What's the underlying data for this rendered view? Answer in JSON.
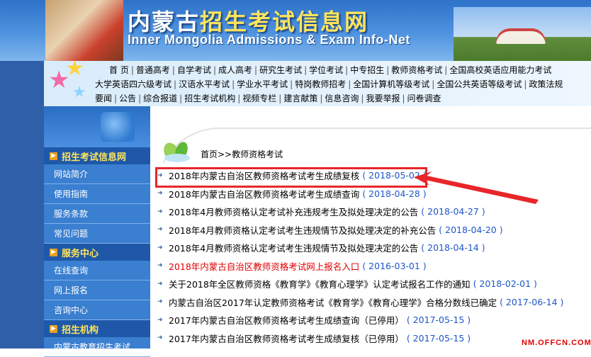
{
  "banner": {
    "title_part1": "内蒙古",
    "title_part2": "招生考试信息网",
    "subtitle": "Inner Mongolia Admissions &  Exam Info-Net"
  },
  "nav": {
    "row1": [
      "首 页",
      "普通高考",
      "自学考试",
      "成人高考",
      "研究生考试",
      "学位考试",
      "中专招生",
      "教师资格考试",
      "全国高校英语应用能力考试"
    ],
    "row2": [
      "大学英语四六级考试",
      "汉语水平考试",
      "学业水平考试",
      "特岗教师招考",
      "全国计算机等级考试",
      "全国公共英语等级考试",
      "政策法规"
    ],
    "row3": [
      "要闻",
      "公告",
      "综合报道",
      "招生考试机构",
      "视频专栏",
      "建言献策",
      "信息咨询",
      "我要举报",
      "问卷调查"
    ]
  },
  "sidebar": {
    "sections": [
      {
        "title": "招生考试信息网",
        "items": [
          "网站简介",
          "使用指南",
          "服务条款",
          "常见问题"
        ]
      },
      {
        "title": "服务中心",
        "items": [
          "在线查询",
          "网上报名",
          "咨询中心"
        ]
      },
      {
        "title": "招生机构",
        "items": [
          "内蒙古教育招生考试"
        ]
      }
    ]
  },
  "breadcrumb": "首页>>教师资格考试",
  "articles": [
    {
      "title": "2018年内蒙古自治区教师资格考试考生成绩复核",
      "date": "( 2018-05-02 )",
      "red": false
    },
    {
      "title": "2018年内蒙古自治区教师资格考试考生成绩查询",
      "date": "( 2018-04-28 )",
      "red": false
    },
    {
      "title": "2018年4月教师资格认定考试补充违规考生及拟处理决定的公告",
      "date": "( 2018-04-27 )",
      "red": false
    },
    {
      "title": "2018年4月教师资格认定考试考生违规情节及拟处理决定的补充公告",
      "date": "( 2018-04-20 )",
      "red": false
    },
    {
      "title": "2018年4月教师资格认定考试考生违规情节及拟处理决定的公告",
      "date": "( 2018-04-14 )",
      "red": false
    },
    {
      "title": "2018年内蒙古自治区教师资格考试网上报名入口",
      "date": "( 2016-03-01 )",
      "red": true
    },
    {
      "title": "关于2018年全区教师资格《教育学》《教育心理学》认定考试报名工作的通知",
      "date": "( 2018-02-01 )",
      "red": false
    },
    {
      "title": "内蒙古自治区2017年认定教师资格考试《教育学》《教育心理学》合格分数线已确定",
      "date": "( 2017-06-14 )",
      "red": false
    },
    {
      "title": "2017年内蒙古自治区教师资格考试考生成绩查询（已停用）",
      "date": "( 2017-05-15 )",
      "red": false
    },
    {
      "title": "2017年内蒙古自治区教师资格考试考生成绩复核（已停用）",
      "date": "( 2017-05-15 )",
      "red": false
    }
  ],
  "watermark": "NM.OFFCN.COM",
  "colors": {
    "accent_red": "#e8262a",
    "link_blue": "#1e56c8",
    "sidebar_blue": "#3a7fd0",
    "title_yellow": "#ffe45c"
  }
}
